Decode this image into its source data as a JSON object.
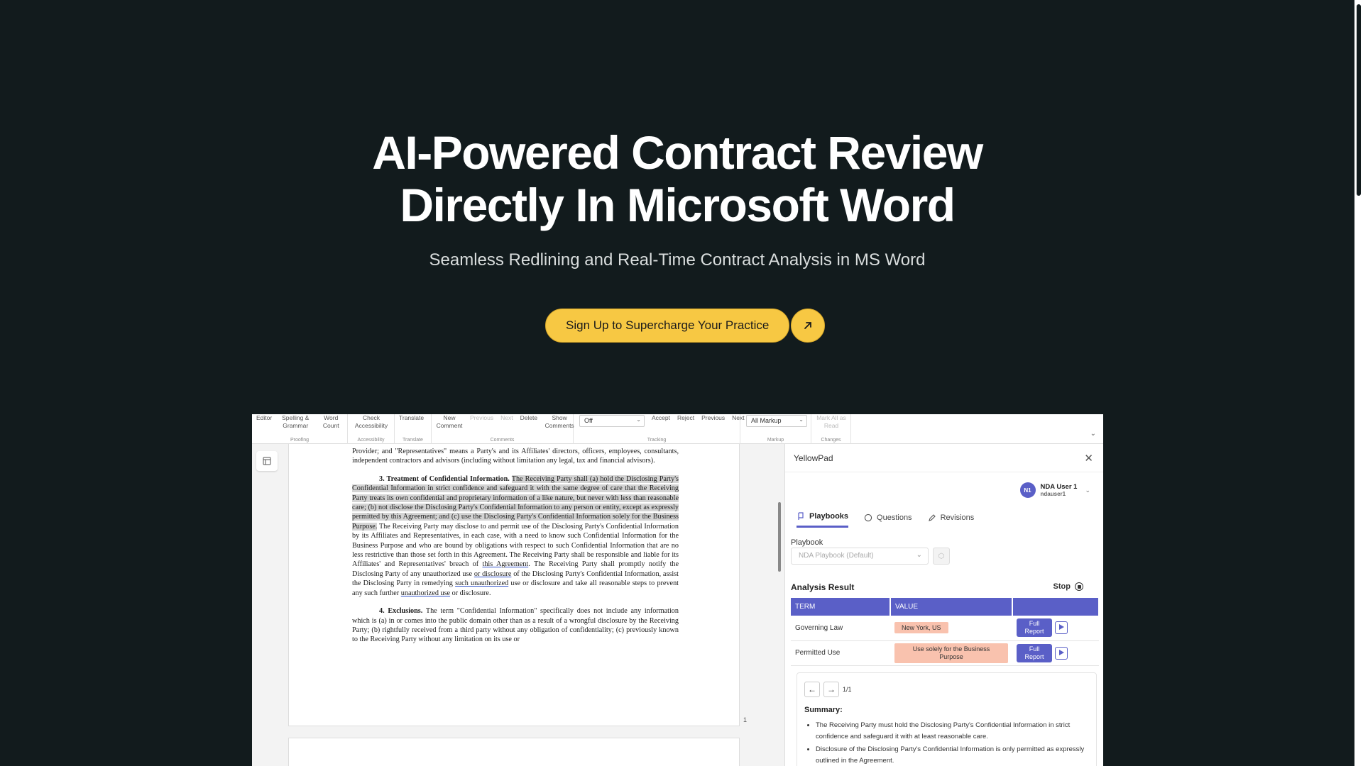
{
  "hero": {
    "title_line1": "AI-Powered Contract Review",
    "title_line2": "Directly In Microsoft Word",
    "subtitle": "Seamless Redlining and Real-Time Contract Analysis in MS Word",
    "cta_label": "Sign Up to Supercharge Your Practice",
    "cta_icon": "arrow-up-right-icon"
  },
  "colors": {
    "background": "#121b1d",
    "cta": "#f7c843",
    "accent": "#5a5fc7",
    "value_pill": "#f9c2ae"
  },
  "ribbon": {
    "proofing": {
      "items": [
        "Editor",
        "Spelling & Grammar",
        "Word Count"
      ],
      "label": "Proofing"
    },
    "accessibility": {
      "items": [
        "Check Accessibility"
      ],
      "label": "Accessibility"
    },
    "translate": {
      "items": [
        "Translate"
      ],
      "label": "Translate"
    },
    "comments": {
      "items": [
        "New Comment",
        "Previous",
        "Next",
        "Delete",
        "Show Comments"
      ],
      "label": "Comments"
    },
    "tracking": {
      "select": "Off",
      "items": [
        "Accept",
        "Reject",
        "Previous",
        "Next"
      ],
      "label": "Tracking"
    },
    "markup": {
      "select": "All Markup",
      "label": "Markup"
    },
    "changes": {
      "items": [
        "Mark All as Read"
      ],
      "label": "Changes"
    }
  },
  "document": {
    "para1": "Provider; and \"Representatives\" means a Party's and its Affiliates' directors, officers, employees, consultants, independent contractors and advisors (including without limitation any legal, tax and financial advisors).",
    "section3_heading": "3. Treatment of Confidential Information.",
    "section3_highlight": "The Receiving Party shall (a) hold the Disclosing Party's Confidential Information in strict confidence and safeguard it with the same degree of care that the Receiving Party treats its own confidential and proprietary information of a like nature, but never with less than reasonable care; (b) not disclose the Disclosing Party's Confidential Information to any person or entity, except as expressly permitted by this Agreement; and (c) use the Disclosing Party's Confidential Information solely for the Business Purpose.",
    "section3_rest_a": " The Receiving Party may disclose to and permit use of the Disclosing Party's Confidential Information by its Affiliates and Representatives, in each case, with a need to know such Confidential Information for the Business Purpose and who are bound by obligations with respect to such Confidential Information that are no less restrictive than those set forth in this Agreement. The Receiving Party shall be responsible and liable for its Affiliates' and Representatives' breach of ",
    "section3_ul1": "this Agreement",
    "section3_rest_b": ". The Receiving Party shall promptly notify the Disclosing Party of any unauthorized use ",
    "section3_ul2": "or disclosure",
    "section3_rest_c": " of the Disclosing Party's Confidential Information, assist the Disclosing Party in remedying ",
    "section3_ul3": "such unauthorized",
    "section3_rest_d": " use or disclosure and take all reasonable steps to prevent any such further ",
    "section3_ul4": "unauthorized use",
    "section3_rest_e": " or disclosure.",
    "section4_heading": "4. Exclusions.",
    "section4_text": " The term \"Confidential Information\" specifically does not include any information which is (a) in or comes into the public domain other than as a result of a wrongful disclosure by the Receiving Party; (b) rightfully received from a third party without any obligation of confidentiality; (c) previously known to the Receiving Party without any limitation on its use or",
    "page_number": "1"
  },
  "pane": {
    "title": "YellowPad",
    "user": {
      "initials": "N1",
      "name": "NDA User 1",
      "id": "ndauser1"
    },
    "tabs": [
      "Playbooks",
      "Questions",
      "Revisions"
    ],
    "playbook_label": "Playbook",
    "playbook_value": "NDA Playbook (Default)",
    "analysis_title": "Analysis Result",
    "stop_label": "Stop",
    "table": {
      "headers": [
        "TERM",
        "VALUE",
        ""
      ],
      "rows": [
        {
          "term": "Governing Law",
          "value": "New York, US",
          "button": "Full Report"
        },
        {
          "term": "Permitted Use",
          "value": "Use solely for the Business Purpose",
          "button": "Full Report"
        }
      ]
    },
    "summary": {
      "pager": "1/1",
      "title": "Summary:",
      "bullets": [
        "The Receiving Party must hold the Disclosing Party's Confidential Information in strict confidence and safeguard it with at least reasonable care.",
        "Disclosure of the Disclosing Party's Confidential Information is only permitted as expressly outlined in the Agreement."
      ]
    }
  }
}
